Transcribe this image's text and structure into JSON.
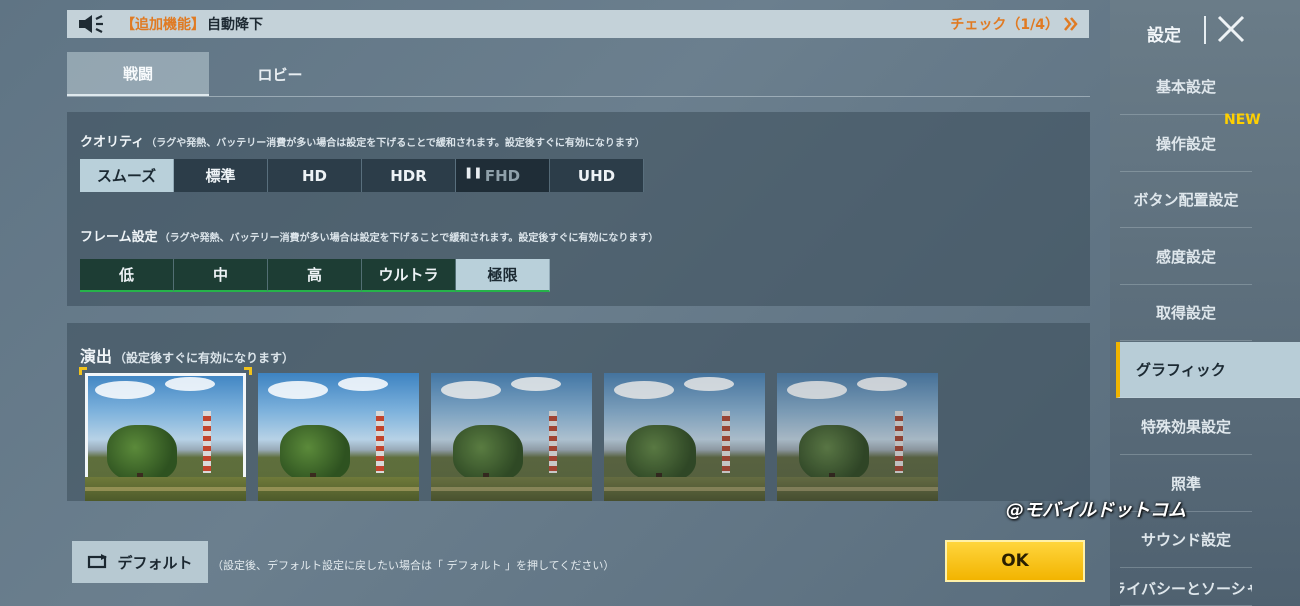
{
  "announcement": {
    "icon": "speaker-icon",
    "tag": "【追加機能】",
    "message": "自動降下",
    "check_label": "チェック（1/4）",
    "check_icon": "double-chevron-right-icon",
    "tag_color": "#e07a22"
  },
  "tabs": [
    {
      "label": "戦闘",
      "active": true
    },
    {
      "label": "ロビー",
      "active": false
    }
  ],
  "quality": {
    "title": "クオリティ",
    "note": "（ラグや発熱、バッテリー消費が多い場合は設定を下げることで緩和されます。設定後すぐに有効になります）",
    "options": [
      "スムーズ",
      "標準",
      "HD",
      "HDR",
      "FHD",
      "UHD"
    ],
    "selected": "スムーズ"
  },
  "frame": {
    "title": "フレーム設定",
    "note": "（ラグや発熱、バッテリー消費が多い場合は設定を下げることで緩和されます。設定後すぐに有効になります）",
    "options": [
      "低",
      "中",
      "高",
      "ウルトラ",
      "極限"
    ],
    "selected": "極限"
  },
  "scene": {
    "title": "演出",
    "note": "（設定後すぐに有効になります）",
    "thumbnails": [
      {
        "name": "scene-thumbnail-1",
        "selected": true
      },
      {
        "name": "scene-thumbnail-2",
        "selected": false
      },
      {
        "name": "scene-thumbnail-3",
        "selected": false
      },
      {
        "name": "scene-thumbnail-4",
        "selected": false
      },
      {
        "name": "scene-thumbnail-5",
        "selected": false
      }
    ]
  },
  "footer": {
    "default_label": "デフォルト",
    "default_icon": "reset-icon",
    "default_note": "（設定後、デフォルト設定に戻したい場合は「 デフォルト 」を押してください）",
    "ok_label": "OK"
  },
  "sidebar": {
    "title": "設定",
    "close_icon": "close-icon",
    "new_badge": "NEW",
    "items": [
      {
        "label": "基本設定"
      },
      {
        "label": "操作設定"
      },
      {
        "label": "ボタン配置設定"
      },
      {
        "label": "感度設定"
      },
      {
        "label": "取得設定"
      },
      {
        "label": "グラフィック"
      },
      {
        "label": "特殊効果設定"
      },
      {
        "label": "照準"
      },
      {
        "label": "サウンド設定"
      },
      {
        "label": "プライバシーとソーシャル"
      }
    ],
    "active": "グラフィック"
  },
  "watermark": "@モバイルドットコム",
  "colors": {
    "accent": "#f0b400",
    "selected_bg": "#b9d0da",
    "frame_bar": "#26b34a"
  }
}
